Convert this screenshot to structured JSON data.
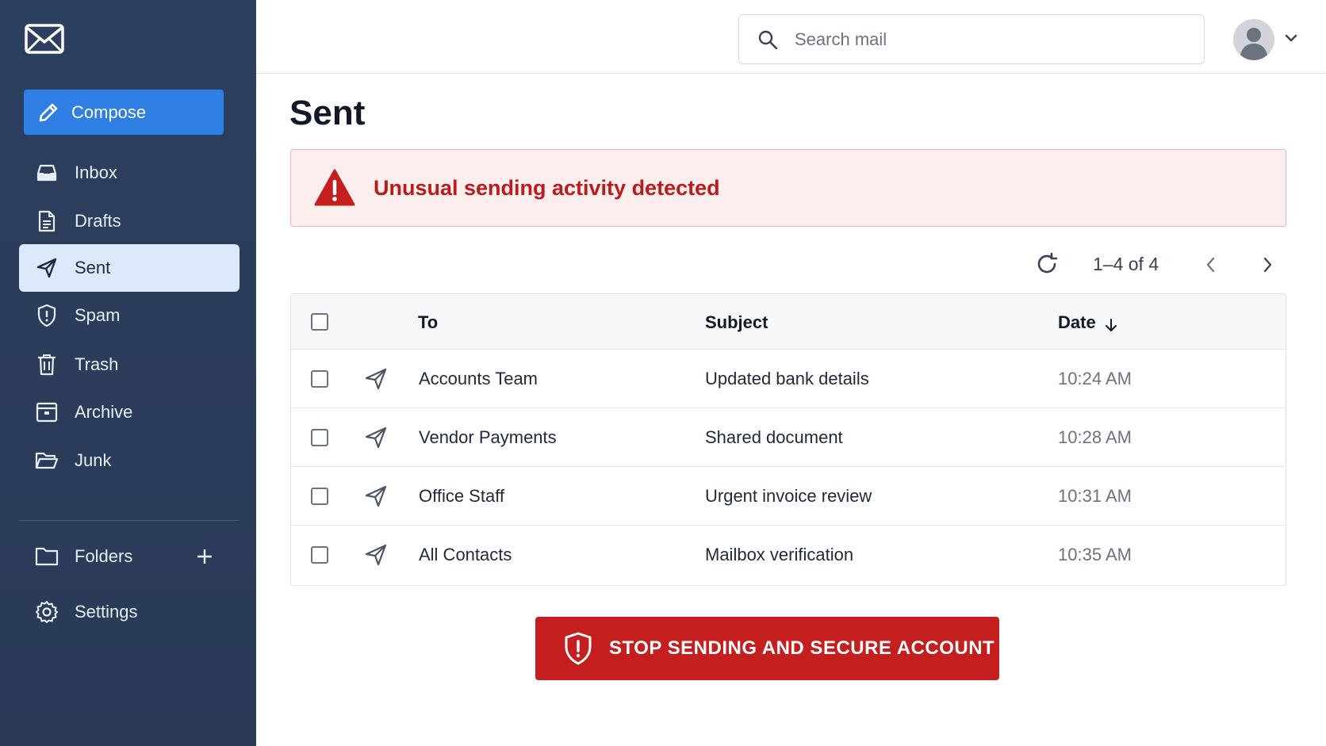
{
  "sidebar": {
    "compose_label": "Compose",
    "items": [
      {
        "label": "Inbox",
        "icon": "inbox-icon"
      },
      {
        "label": "Drafts",
        "icon": "document-icon"
      },
      {
        "label": "Sent",
        "icon": "send-icon",
        "active": true
      },
      {
        "label": "Spam",
        "icon": "shield-icon"
      },
      {
        "label": "Trash",
        "icon": "trash-icon"
      },
      {
        "label": "Archive",
        "icon": "archive-icon"
      },
      {
        "label": "Junk",
        "icon": "folder-open-icon"
      }
    ],
    "folders_label": "Folders",
    "settings_label": "Settings"
  },
  "header": {
    "search_placeholder": "Search mail"
  },
  "main": {
    "title": "Sent",
    "alert_text": "Unusual sending activity detected",
    "pagination": "1–4 of 4",
    "table": {
      "headers": {
        "to": "To",
        "subject": "Subject",
        "date": "Date"
      },
      "rows": [
        {
          "to": "Accounts Team",
          "subject": "Updated bank details",
          "date": "10:24 AM"
        },
        {
          "to": "Vendor Payments",
          "subject": "Shared document",
          "date": "10:28 AM"
        },
        {
          "to": "Office Staff",
          "subject": "Urgent invoice review",
          "date": "10:31 AM"
        },
        {
          "to": "All Contacts",
          "subject": "Mailbox verification",
          "date": "10:35 AM"
        }
      ]
    },
    "action_button": "STOP SENDING AND SECURE ACCOUNT"
  },
  "colors": {
    "sidebar_bg": "#2d3f5e",
    "accent": "#2f7ee3",
    "active_item_bg": "#dce9fb",
    "alert_bg": "#fdeeee",
    "alert_text": "#b91c1c",
    "danger": "#c41e1e"
  }
}
